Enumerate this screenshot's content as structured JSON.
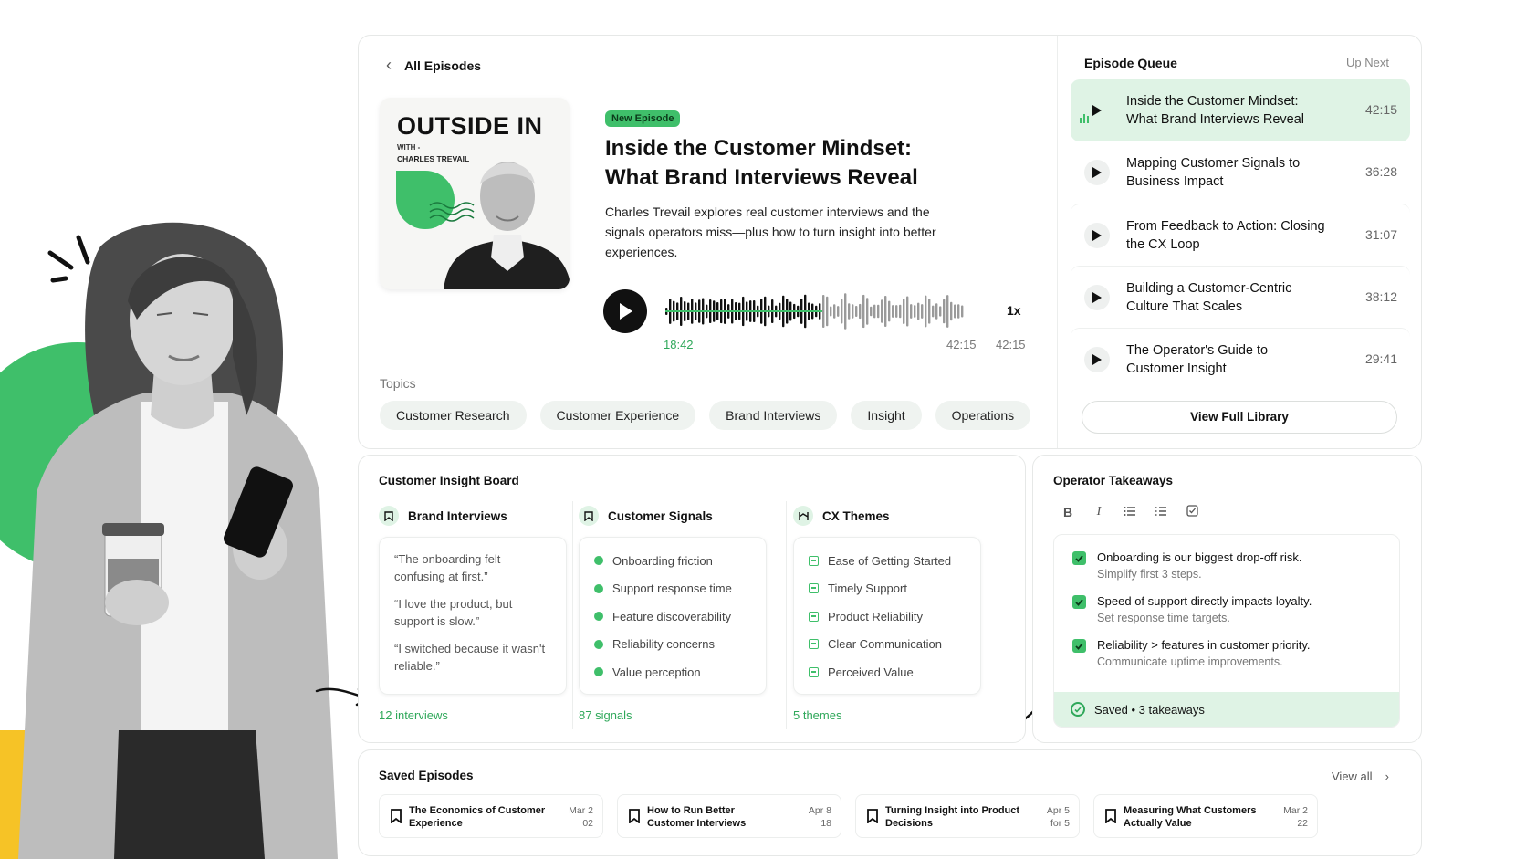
{
  "player": {
    "back_label": "All Episodes",
    "cover": {
      "title": "OUTSIDE IN",
      "with": "WITH -",
      "host": "CHARLES TREVAIL"
    },
    "badge": "New Episode",
    "title": "Inside the Customer Mindset: What Brand Interviews Reveal",
    "description": "Charles Trevail explores real customer interviews and the signals operators miss—plus how to turn insight into better experiences.",
    "current_time": "18:42",
    "mid_time": "42:15",
    "total_time": "42:15",
    "speed": "1x",
    "progress": 0.53
  },
  "topics": {
    "label": "Topics",
    "items": [
      "Customer Research",
      "Customer Experience",
      "Brand Interviews",
      "Insight",
      "Operations"
    ]
  },
  "queue": {
    "title": "Episode Queue",
    "up_next": "Up Next",
    "items": [
      {
        "title": "Inside the Customer Mindset: What Brand Interviews Reveal",
        "time": "42:15"
      },
      {
        "title": "Mapping Customer Signals to Business Impact",
        "time": "36:28"
      },
      {
        "title": "From Feedback to Action: Closing the CX Loop",
        "time": "31:07"
      },
      {
        "title": "Building a Customer-Centric Culture That Scales",
        "time": "38:12"
      },
      {
        "title": "The Operator's Guide to Customer Insight",
        "time": "29:41"
      }
    ],
    "view_library": "View Full Library"
  },
  "board": {
    "title": "Customer Insight Board",
    "interviews": {
      "title": "Brand Interviews",
      "quotes": [
        "“The onboarding felt confusing at first.”",
        "“I love the product, but support is slow.”",
        "“I switched because it wasn't reliable.”"
      ],
      "footer": "12 interviews"
    },
    "signals": {
      "title": "Customer Signals",
      "items": [
        "Onboarding friction",
        "Support response time",
        "Feature discoverability",
        "Reliability concerns",
        "Value perception"
      ],
      "footer": "87 signals"
    },
    "themes": {
      "title": "CX Themes",
      "items": [
        "Ease of Getting Started",
        "Timely Support",
        "Product Reliability",
        "Clear Communication",
        "Perceived Value"
      ],
      "footer": "5 themes"
    }
  },
  "takeaways": {
    "title": "Operator Takeaways",
    "toolbar": {
      "bold": "B",
      "italic": "I"
    },
    "items": [
      {
        "main": "Onboarding is our biggest drop-off risk.",
        "sub": "Simplify first 3 steps."
      },
      {
        "main": "Speed of support directly impacts loyalty.",
        "sub": "Set response time targets."
      },
      {
        "main": "Reliability > features in customer priority.",
        "sub": "Communicate uptime improvements."
      }
    ],
    "saved": "Saved • 3 takeaways"
  },
  "saved_episodes": {
    "title": "Saved Episodes",
    "view_all": "View all",
    "items": [
      {
        "title": "The Economics of Customer Experience",
        "date1": "Mar 2",
        "date2": "02"
      },
      {
        "title": "How to Run Better Customer Interviews",
        "date1": "Apr 8",
        "date2": "18"
      },
      {
        "title": "Turning Insight into Product Decisions",
        "date1": "Apr 5",
        "date2": "for 5"
      },
      {
        "title": "Measuring What Customers Actually Value",
        "date1": "Mar 2",
        "date2": "22"
      }
    ]
  },
  "colors": {
    "accent": "#3fbf6a",
    "accent_light": "#dff3e5",
    "yellow": "#f6c326"
  }
}
